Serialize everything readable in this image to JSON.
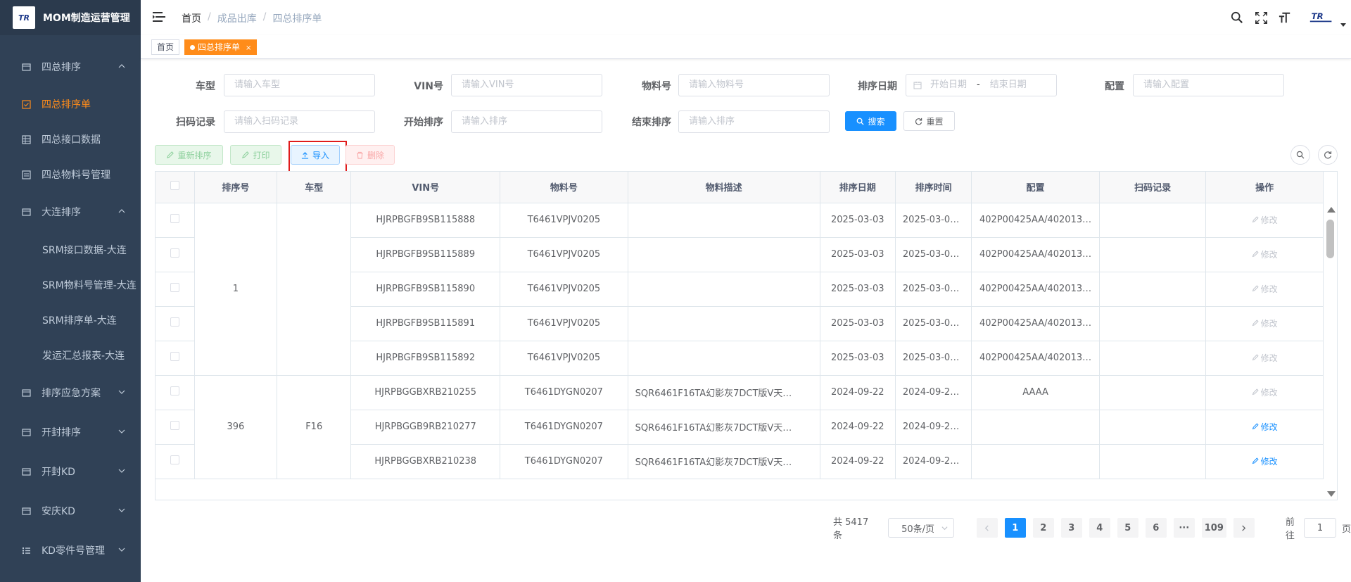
{
  "app": {
    "title": "MOM制造运营管理",
    "logo_text": "TR"
  },
  "sidebar": {
    "items": [
      {
        "label": "四总排序",
        "icon": "menu-icon",
        "expanded": true
      },
      {
        "label": "四总排序单",
        "icon": "checkbox-icon",
        "active": true
      },
      {
        "label": "四总接口数据",
        "icon": "grid-icon"
      },
      {
        "label": "四总物料号管理",
        "icon": "list-icon"
      },
      {
        "label": "大连排序",
        "icon": "menu-icon",
        "expanded": true
      },
      {
        "label": "SRM接口数据-大连"
      },
      {
        "label": "SRM物料号管理-大连"
      },
      {
        "label": "SRM排序单-大连"
      },
      {
        "label": "发运汇总报表-大连"
      },
      {
        "label": "排序应急方案",
        "icon": "menu-icon",
        "expanded": false
      },
      {
        "label": "开封排序",
        "icon": "menu-icon",
        "expanded": false
      },
      {
        "label": "开封KD",
        "icon": "menu-icon",
        "expanded": false
      },
      {
        "label": "安庆KD",
        "icon": "menu-icon",
        "expanded": false
      },
      {
        "label": "KD零件号管理",
        "icon": "list-bullets-icon",
        "expanded": false
      }
    ]
  },
  "breadcrumb": [
    "首页",
    "成品出库",
    "四总排序单"
  ],
  "tags": [
    {
      "label": "首页"
    },
    {
      "label": "四总排序单",
      "active": true,
      "close": "×"
    }
  ],
  "filters": {
    "chexing": {
      "label": "车型",
      "placeholder": "请输入车型"
    },
    "vin": {
      "label": "VIN号",
      "placeholder": "请输入VIN号"
    },
    "wuliao": {
      "label": "物料号",
      "placeholder": "请输入物料号"
    },
    "date": {
      "label": "排序日期",
      "start": "开始日期",
      "sep": "-",
      "end": "结束日期"
    },
    "peizhi": {
      "label": "配置",
      "placeholder": "请输入配置"
    },
    "saoma": {
      "label": "扫码记录",
      "placeholder": "请输入扫码记录"
    },
    "start_sort": {
      "label": "开始排序",
      "placeholder": "请输入排序"
    },
    "end_sort": {
      "label": "结束排序",
      "placeholder": "请输入排序"
    },
    "search_label": "搜索",
    "reset_label": "重置"
  },
  "toolbar": {
    "resort_label": "重新排序",
    "print_label": "打印",
    "import_label": "导入",
    "delete_label": "删除"
  },
  "table": {
    "headers": [
      "排序号",
      "车型",
      "VIN号",
      "物料号",
      "物料描述",
      "排序日期",
      "排序时间",
      "配置",
      "扫码记录",
      "操作"
    ],
    "groups": [
      {
        "sort_no": "1",
        "model": "",
        "rows": [
          {
            "vin": "HJRPBGFB9SB115888",
            "material": "T6461VPJV0205",
            "desc": "",
            "date": "2025-03-03",
            "time": "2025-03-03…",
            "config": "402P00425AA/402013…",
            "scan": "",
            "action": "修改",
            "enabled": false
          },
          {
            "vin": "HJRPBGFB9SB115889",
            "material": "T6461VPJV0205",
            "desc": "",
            "date": "2025-03-03",
            "time": "2025-03-03…",
            "config": "402P00425AA/402013…",
            "scan": "",
            "action": "修改",
            "enabled": false
          },
          {
            "vin": "HJRPBGFB9SB115890",
            "material": "T6461VPJV0205",
            "desc": "",
            "date": "2025-03-03",
            "time": "2025-03-03…",
            "config": "402P00425AA/402013…",
            "scan": "",
            "action": "修改",
            "enabled": false
          },
          {
            "vin": "HJRPBGFB9SB115891",
            "material": "T6461VPJV0205",
            "desc": "",
            "date": "2025-03-03",
            "time": "2025-03-03…",
            "config": "402P00425AA/402013…",
            "scan": "",
            "action": "修改",
            "enabled": false
          },
          {
            "vin": "HJRPBGFB9SB115892",
            "material": "T6461VPJV0205",
            "desc": "",
            "date": "2025-03-03",
            "time": "2025-03-03…",
            "config": "402P00425AA/402013…",
            "scan": "",
            "action": "修改",
            "enabled": false
          }
        ]
      },
      {
        "sort_no": "396",
        "model": "F16",
        "rows": [
          {
            "vin": "HJRPBGGBXRB210255",
            "material": "T6461DYGN0207",
            "desc": "SQR6461F16TA幻影灰7DCT版Ⅴ天…",
            "date": "2024-09-22",
            "time": "2024-09-22…",
            "config": "AAAA",
            "scan": "",
            "action": "修改",
            "enabled": false
          },
          {
            "vin": "HJRPBGGB9RB210277",
            "material": "T6461DYGN0207",
            "desc": "SQR6461F16TA幻影灰7DCT版Ⅴ天…",
            "date": "2024-09-22",
            "time": "2024-09-22…",
            "config": "",
            "scan": "",
            "action": "修改",
            "enabled": true
          },
          {
            "vin": "HJRPBGGBXRB210238",
            "material": "T6461DYGN0207",
            "desc": "SQR6461F16TA幻影灰7DCT版Ⅴ天…",
            "date": "2024-09-22",
            "time": "2024-09-22…",
            "config": "",
            "scan": "",
            "action": "修改",
            "enabled": true
          }
        ]
      }
    ]
  },
  "pagination": {
    "total": "共 5417 条",
    "page_size": "50条/页",
    "pages": [
      "1",
      "2",
      "3",
      "4",
      "5",
      "6",
      "···",
      "109"
    ],
    "current": "1",
    "goto_prefix": "前往",
    "goto_value": "1",
    "goto_suffix": "页"
  },
  "colors": {
    "sidebar_bg": "#304156",
    "accent": "#ff8c1a",
    "primary": "#1890ff",
    "highlight": "#e01b1b"
  }
}
